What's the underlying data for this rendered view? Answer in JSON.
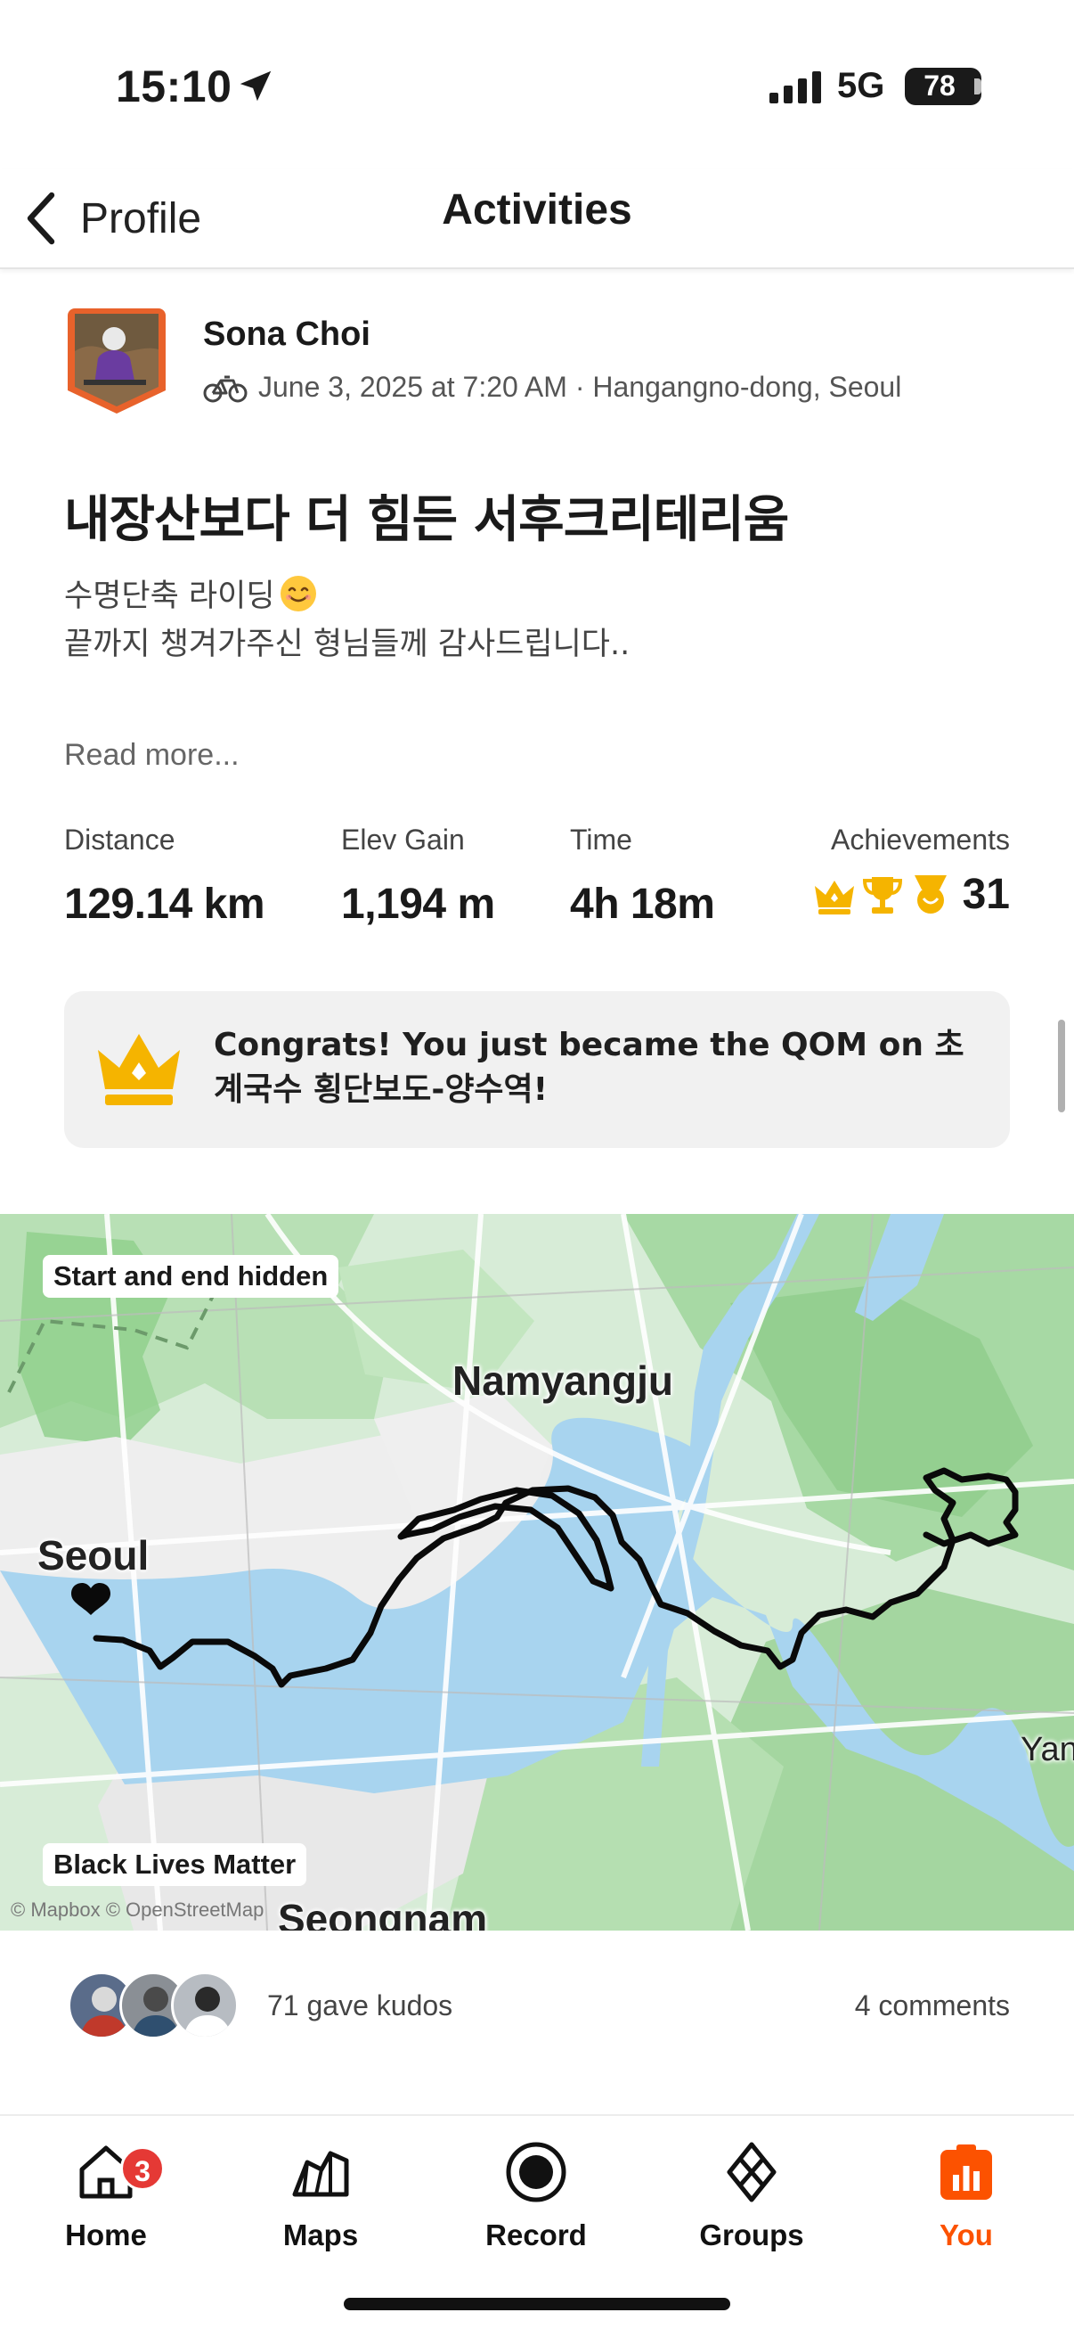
{
  "status_bar": {
    "time": "15:10",
    "network": "5G",
    "battery": "78"
  },
  "nav": {
    "back_label": "Profile",
    "title": "Activities"
  },
  "activity": {
    "athlete_name": "Sona Choi",
    "meta": "June 3, 2025 at 7:20 AM · Hangangno-dong, Seoul",
    "title": "내장산보다 더 힘든 서후크리테리움",
    "description_line1": "수명단축 라이딩",
    "description_line2": "끝까지 챙겨가주신 형님들께 감사드립니다..",
    "read_more": "Read more..."
  },
  "stats": [
    {
      "label": "Distance",
      "value": "129.14 km"
    },
    {
      "label": "Elev Gain",
      "value": "1,194 m"
    },
    {
      "label": "Time",
      "value": "4h 18m"
    }
  ],
  "achievements": {
    "label": "Achievements",
    "count": "31",
    "icons": [
      "crown-icon",
      "trophy-icon",
      "medal-icon"
    ]
  },
  "banner": {
    "text": "Congrats! You just became the QOM on 초계국수 횡단보도-양수역!"
  },
  "map": {
    "privacy_label": "Start and end hidden",
    "overlay_label": "Black Lives Matter",
    "cities": {
      "namyangju": "Namyangju",
      "seoul": "Seoul",
      "seongnam": "Seongnam",
      "yang": "Yan"
    },
    "attribution": "© Mapbox © OpenStreetMap"
  },
  "social": {
    "kudos": "71 gave kudos",
    "comments": "4 comments"
  },
  "tabs": [
    {
      "label": "Home",
      "badge": "3"
    },
    {
      "label": "Maps"
    },
    {
      "label": "Record"
    },
    {
      "label": "Groups"
    },
    {
      "label": "You"
    }
  ],
  "colors": {
    "accent": "#fc5200",
    "qom_gold": "#f5b400",
    "badge_red": "#e53935",
    "map_green": "#a8d8a8",
    "water": "#a8d4ef"
  }
}
